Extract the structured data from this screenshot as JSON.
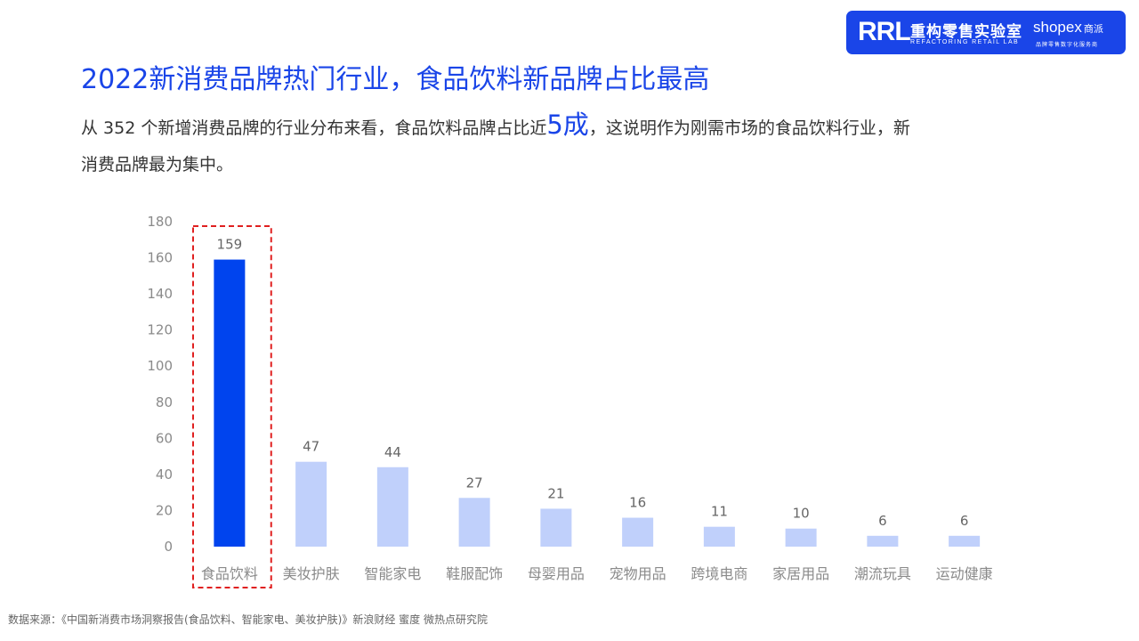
{
  "logo": {
    "mark": "RRL",
    "name_cn": "重构零售实验室",
    "name_en": "REFACTORING RETAIL LAB",
    "partner": "shopex",
    "partner_cn": "商派",
    "partner_sub": "品牌零售数字化服务商",
    "color": "#1a45e8"
  },
  "title": "2022新消费品牌热门行业，食品饮料新品牌占比最高",
  "description": {
    "part1": "从  352  个新增消费品牌的行业分布来看，食品饮料品牌占比近",
    "highlight": "5成",
    "part2": "，这说明作为刚需市场的食品饮料行业，新消费品牌最为集中。"
  },
  "chart_data": {
    "type": "bar",
    "categories": [
      "食品饮料",
      "美妆护肤",
      "智能家电",
      "鞋服配饰",
      "母婴用品",
      "宠物用品",
      "跨境电商",
      "家居用品",
      "潮流玩具",
      "运动健康"
    ],
    "values": [
      159,
      47,
      44,
      27,
      21,
      16,
      11,
      10,
      6,
      6
    ],
    "ylim": [
      0,
      180
    ],
    "yticks": [
      0,
      20,
      40,
      60,
      80,
      100,
      120,
      140,
      160,
      180
    ],
    "grid": false,
    "highlight_index": 0,
    "highlight_color": "#0044ee",
    "bar_color": "#c0d0fb",
    "box_color": "#e02020"
  },
  "source": "数据来源：《中国新消费市场洞察报告(食品饮料、智能家电、美妆护肤)》新浪财经 蜜度 微热点研究院"
}
